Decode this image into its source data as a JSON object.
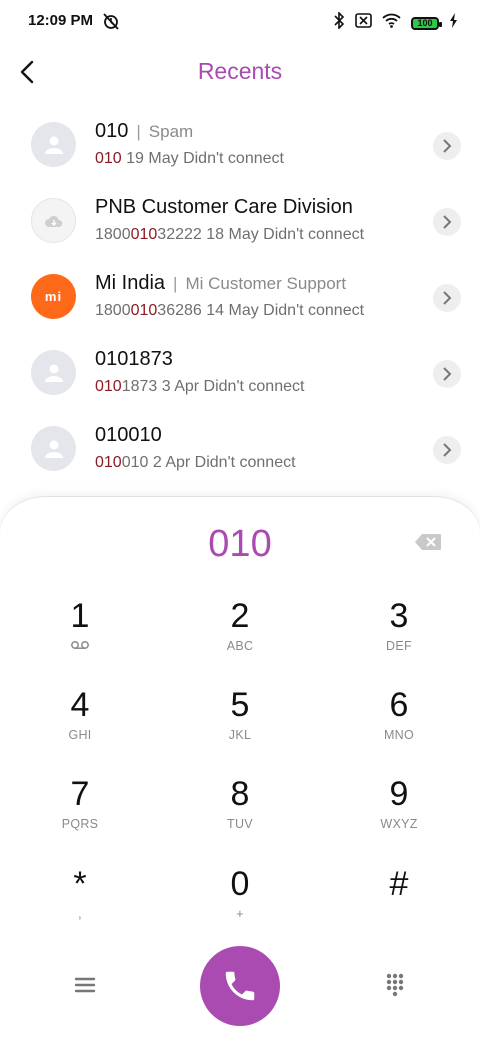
{
  "status_bar": {
    "time": "12:09 PM",
    "battery_label": "100"
  },
  "header": {
    "title": "Recents"
  },
  "recents": [
    {
      "name": "010",
      "tag": "Spam",
      "number_prefix": "",
      "number_highlight": "010",
      "number_suffix": "",
      "date_status": " 19 May Didn't connect",
      "avatar": "person-icon"
    },
    {
      "name": "PNB Customer Care Division",
      "tag": "",
      "number_prefix": "1800",
      "number_highlight": "010",
      "number_suffix": "32222",
      "date_status": " 18 May Didn't connect",
      "avatar": "cloud-icon"
    },
    {
      "name": "Mi India",
      "tag": "Mi Customer Support",
      "number_prefix": "1800",
      "number_highlight": "010",
      "number_suffix": "36286",
      "date_status": " 14 May Didn't connect",
      "avatar": "mi-logo-icon",
      "avatar_text": "mi"
    },
    {
      "name": "0101873",
      "tag": "",
      "number_prefix": "",
      "number_highlight": "010",
      "number_suffix": "1873",
      "date_status": " 3 Apr Didn't connect",
      "avatar": "person-icon"
    },
    {
      "name": "010010",
      "tag": "",
      "number_prefix": "",
      "number_highlight": "010",
      "number_suffix": "010",
      "date_status": " 2 Apr Didn't connect",
      "avatar": "person-icon"
    }
  ],
  "dialer": {
    "entered_number": "010",
    "keys": [
      {
        "digit": "1",
        "letters": ""
      },
      {
        "digit": "2",
        "letters": "ABC"
      },
      {
        "digit": "3",
        "letters": "DEF"
      },
      {
        "digit": "4",
        "letters": "GHI"
      },
      {
        "digit": "5",
        "letters": "JKL"
      },
      {
        "digit": "6",
        "letters": "MNO"
      },
      {
        "digit": "7",
        "letters": "PQRS"
      },
      {
        "digit": "8",
        "letters": "TUV"
      },
      {
        "digit": "9",
        "letters": "WXYZ"
      },
      {
        "digit": "*",
        "letters": ","
      },
      {
        "digit": "0",
        "letters": "+"
      },
      {
        "digit": "#",
        "letters": ""
      }
    ]
  },
  "colors": {
    "accent": "#a94bb0",
    "highlight": "#8e1b22",
    "mi_orange": "#ff6a1a"
  }
}
